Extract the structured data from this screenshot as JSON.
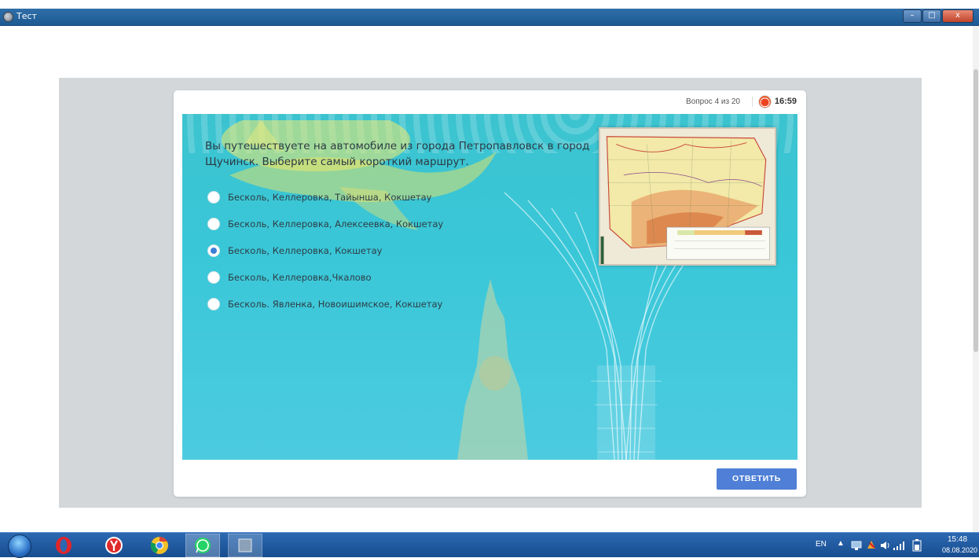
{
  "window": {
    "title": "Тест",
    "minimize": "–",
    "maximize": "□",
    "close": "x"
  },
  "quiz": {
    "question_counter": "Вопрос 4 из 20",
    "timer": "16:59",
    "question": "Вы путешествуете на автомобиле из города Петропавловск в город Щучинск. Выберите самый короткий маршрут.",
    "options": [
      {
        "label": "Бесколь, Келлеровка, Тайынша, Кокшетау",
        "selected": false
      },
      {
        "label": "Бесколь, Келлеровка, Алексеевка,  Кокшетау",
        "selected": false
      },
      {
        "label": "Бесколь, Келлеровка, Кокшетау",
        "selected": true
      },
      {
        "label": "Бесколь, Келлеровка,Чкалово",
        "selected": false
      },
      {
        "label": "Бесколь. Явленка, Новоишимское, Кокшетау",
        "selected": false
      }
    ],
    "submit_label": "ОТВЕТИТЬ"
  },
  "taskbar": {
    "apps": [
      "opera-icon",
      "yandex-browser-icon",
      "chrome-icon",
      "whatsapp-icon",
      "window-app-icon"
    ],
    "language": "EN",
    "time": "15:48",
    "date": "08.08.2020"
  },
  "colors": {
    "accent": "#4f7fd6",
    "panel": "#39c7d8",
    "titlebar": "#2f6ea8"
  }
}
